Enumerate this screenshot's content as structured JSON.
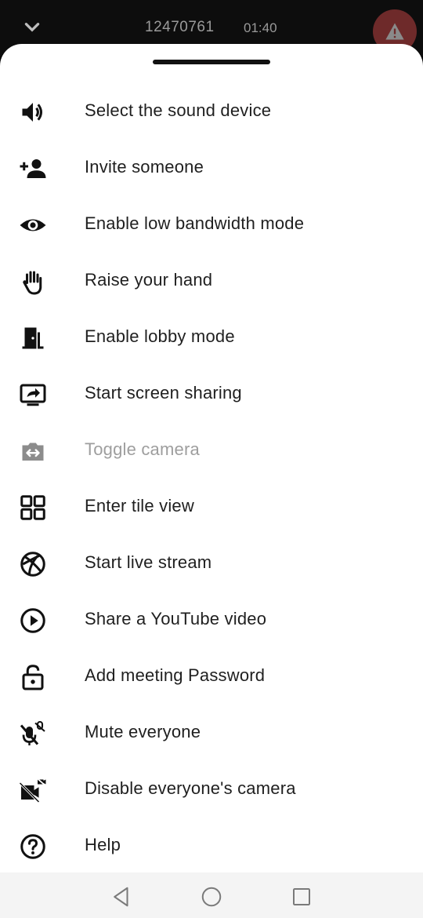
{
  "topbar": {
    "meeting_id": "12470761",
    "timer": "01:40",
    "chevron_icon": "chevron-down-icon",
    "warning_icon": "warning-icon"
  },
  "menu": {
    "items": [
      {
        "label": "Select the sound device",
        "icon": "speaker-icon",
        "enabled": true
      },
      {
        "label": "Invite someone",
        "icon": "person-add-icon",
        "enabled": true
      },
      {
        "label": "Enable low bandwidth mode",
        "icon": "eye-icon",
        "enabled": true
      },
      {
        "label": "Raise your hand",
        "icon": "hand-icon",
        "enabled": true
      },
      {
        "label": "Enable lobby mode",
        "icon": "door-icon",
        "enabled": true
      },
      {
        "label": "Start screen sharing",
        "icon": "screen-share-icon",
        "enabled": true
      },
      {
        "label": "Toggle camera",
        "icon": "switch-camera-icon",
        "enabled": false
      },
      {
        "label": "Enter tile view",
        "icon": "tile-view-icon",
        "enabled": true
      },
      {
        "label": "Start live stream",
        "icon": "globe-icon",
        "enabled": true
      },
      {
        "label": "Share a YouTube video",
        "icon": "play-circle-icon",
        "enabled": true
      },
      {
        "label": "Add meeting Password",
        "icon": "lock-icon",
        "enabled": true
      },
      {
        "label": "Mute everyone",
        "icon": "mic-off-icon",
        "enabled": true
      },
      {
        "label": "Disable everyone's camera",
        "icon": "camera-off-icon",
        "enabled": true
      },
      {
        "label": "Help",
        "icon": "help-icon",
        "enabled": true
      }
    ]
  },
  "navbar": {
    "back_icon": "back-triangle-icon",
    "home_icon": "home-circle-icon",
    "recents_icon": "recents-square-icon"
  },
  "colors": {
    "sheet_bg": "#ffffff",
    "text": "#1f1f1f",
    "disabled_text": "#9e9e9e",
    "topbar_bg": "#0d0d0d",
    "warning_bg": "#6e2a2a"
  }
}
